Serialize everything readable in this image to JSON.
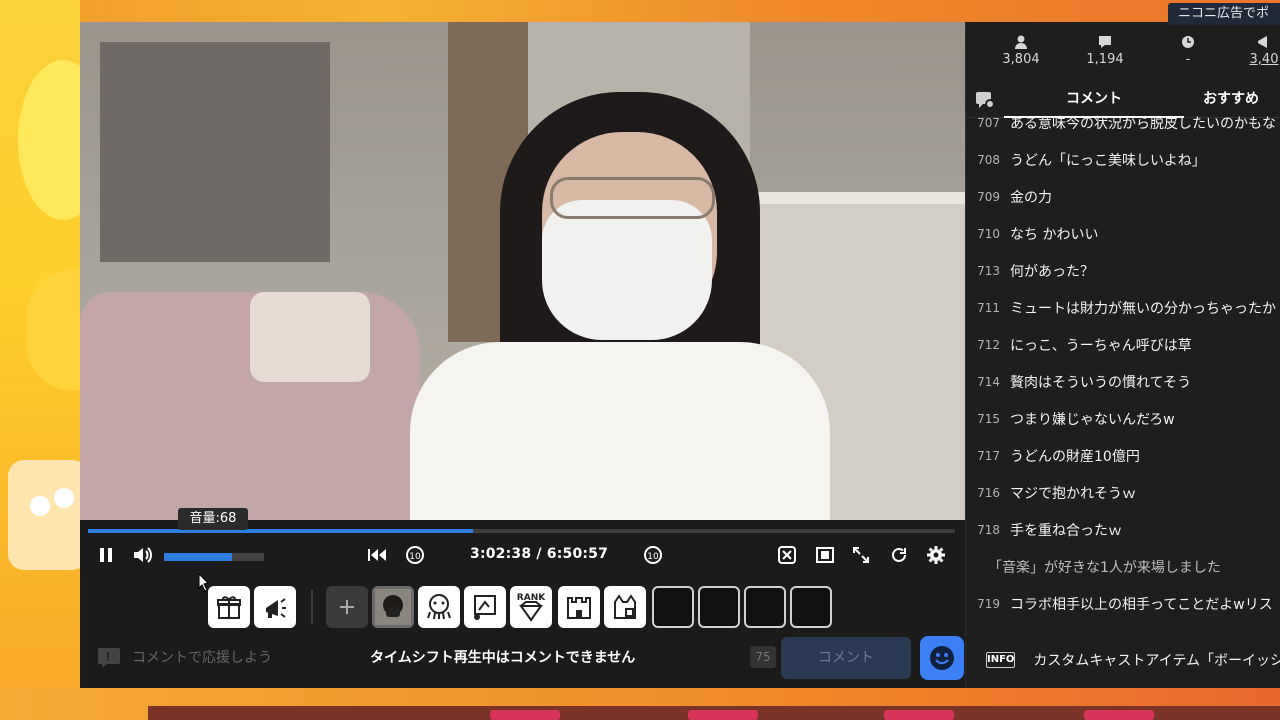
{
  "ad_tab": "ニコニ広告でポ",
  "stats": {
    "viewers": "3,804",
    "comments": "1,194",
    "time": "-",
    "ad_points": "3,40"
  },
  "tabs": {
    "comment": "コメント",
    "recommend": "おすすめ"
  },
  "comments": [
    {
      "no": "707",
      "text": "ある意味今の状況から脱皮したいのかもな"
    },
    {
      "no": "708",
      "text": "うどん「にっこ美味しいよね」"
    },
    {
      "no": "709",
      "text": "金の力"
    },
    {
      "no": "710",
      "text": "なち かわいい"
    },
    {
      "no": "713",
      "text": "何があった？"
    },
    {
      "no": "711",
      "text": "ミュートは財力が無いの分かっちゃったか"
    },
    {
      "no": "712",
      "text": "にっこ、うーちゃん呼びは草"
    },
    {
      "no": "714",
      "text": "贅肉はそういうの慣れてそう"
    },
    {
      "no": "715",
      "text": "つまり嫌じゃないんだろw"
    },
    {
      "no": "717",
      "text": "うどんの財産10億円"
    },
    {
      "no": "716",
      "text": "マジで抱かれそうｗ"
    },
    {
      "no": "718",
      "text": "手を重ね合ったｗ"
    },
    {
      "no": "",
      "text": "「音楽」が好きな1人が来場しました"
    },
    {
      "no": "719",
      "text": "コラボ相手以上の相手ってことだよwリス"
    }
  ],
  "info": {
    "badge": "INFO",
    "text": "カスタムキャストアイテム「ボーイッシ"
  },
  "player": {
    "volume_tooltip": "音量:68",
    "volume": 68,
    "progress": 0.4443,
    "time": "3:02:38 / 6:50:57"
  },
  "commentbar": {
    "placeholder": "コメントで応援しよう",
    "disabled_message": "タイムシフト再生中はコメントできません",
    "count": "75",
    "submit": "コメント"
  },
  "items": {
    "rank_label": "RANK"
  },
  "colors": {
    "accent": "#2e7de1",
    "emoji_button": "#3d7ff5",
    "banner": "#f08a2a"
  }
}
